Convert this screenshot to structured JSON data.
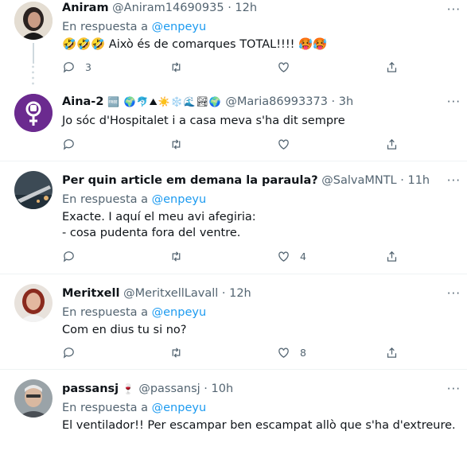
{
  "tweets": [
    {
      "name": "Aniram",
      "name_emojis": "",
      "handle": "@Aniram14690935",
      "time": "12h",
      "reply_prefix": "En respuesta a",
      "reply_to": "@enpeyu",
      "text": "🤣🤣🤣 Això és de comarques TOTAL!!!! 🥵🥵",
      "counts": {
        "reply": "3",
        "retweet": "",
        "like": "",
        "share": ""
      }
    },
    {
      "name": "Aina-2",
      "name_emojis": "🆓 🌍🐬⛰☀️❄️🌊🏞🌍",
      "handle": "@Maria86993373",
      "time": "3h",
      "reply_prefix": "",
      "reply_to": "",
      "text": "Jo sóc d'Hospitalet i a casa meva s'ha dit sempre",
      "counts": {
        "reply": "",
        "retweet": "",
        "like": "",
        "share": ""
      }
    },
    {
      "name": "Per quin article em demana la paraula?",
      "name_emojis": "",
      "handle": "@SalvaMNTL",
      "time": "11h",
      "reply_prefix": "En respuesta a",
      "reply_to": "@enpeyu",
      "text": "Exacte. I aquí el meu avi afegiria:\n- cosa pudenta fora del ventre.",
      "counts": {
        "reply": "",
        "retweet": "",
        "like": "4",
        "share": ""
      }
    },
    {
      "name": "Meritxell",
      "name_emojis": "",
      "handle": "@MeritxellLavall",
      "time": "12h",
      "reply_prefix": "En respuesta a",
      "reply_to": "@enpeyu",
      "text": "Com en dius tu si no?",
      "counts": {
        "reply": "",
        "retweet": "",
        "like": "8",
        "share": ""
      }
    },
    {
      "name": "passansj",
      "name_emojis": "🍷",
      "handle": "@passansj",
      "time": "10h",
      "reply_prefix": "En respuesta a",
      "reply_to": "@enpeyu",
      "text": "El ventilador!! Per escampar ben escampat allò  que s'ha d'extreure.",
      "counts": {
        "reply": "",
        "retweet": "",
        "like": "",
        "share": ""
      }
    }
  ],
  "separator": "·",
  "more_label": "···",
  "colors": {
    "accent": "#1d9bf0",
    "muted": "#536471",
    "text": "#0f1419",
    "venus": "#6b2a8f"
  }
}
